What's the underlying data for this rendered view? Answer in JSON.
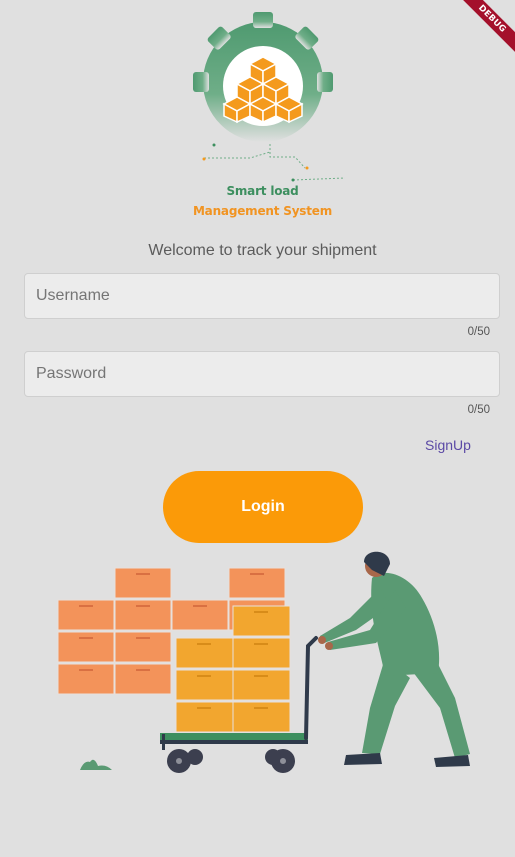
{
  "app": {
    "debug_label": "DEBUG"
  },
  "logo": {
    "line1": "Smart load",
    "line2": "Management System",
    "icon": "gear-boxes-logo-icon"
  },
  "welcome_text": "Welcome to track your shipment",
  "form": {
    "username": {
      "value": "",
      "placeholder": "Username",
      "counter": "0/50"
    },
    "password": {
      "value": "",
      "placeholder": "Password",
      "counter": "0/50"
    }
  },
  "signup_label": "SignUp",
  "login_label": "Login",
  "illustration": {
    "icon": "man-pushing-cart-illustration"
  },
  "colors": {
    "background": "#e0e0e0",
    "accent_orange": "#fb9a08",
    "brand_green": "#3d8f5f",
    "link_purple": "#5b49a5",
    "box_orange": "#f3935a",
    "box_yellow": "#f2a62f"
  }
}
